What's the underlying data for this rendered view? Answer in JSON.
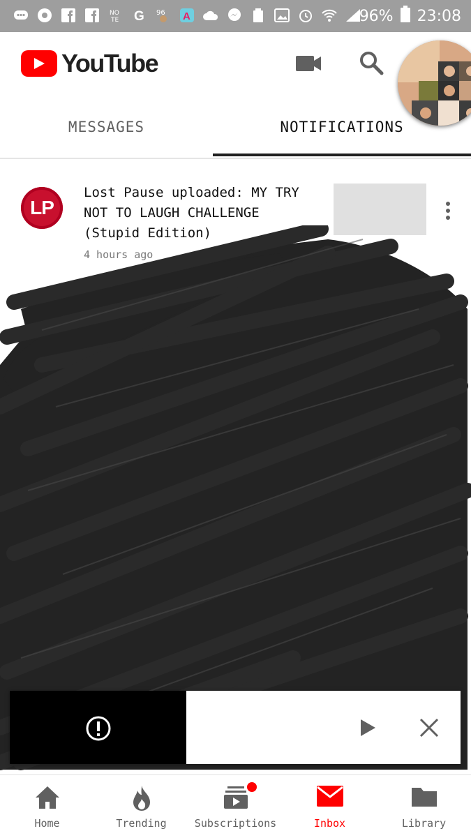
{
  "status_bar": {
    "battery": "96%",
    "time": "23:08",
    "icons": [
      "chat-icon",
      "chrome-icon",
      "facebook-icon",
      "facebook-icon",
      "note-icon",
      "google-icon",
      "notification-icon",
      "app-icon",
      "cloud-icon",
      "messenger-icon",
      "recycle-icon",
      "image-icon",
      "alarm-icon",
      "wifi-icon",
      "signal-icon",
      "battery-icon"
    ]
  },
  "header": {
    "brand": "YouTube",
    "brand_color": "#ff0000",
    "camera_icon": "video-camera-icon",
    "search_icon": "search-icon"
  },
  "tabs": [
    {
      "label": "MESSAGES",
      "active": false
    },
    {
      "label": "NOTIFICATIONS",
      "active": true
    }
  ],
  "notifications": [
    {
      "avatar_text": "LP",
      "text": "Lost Pause uploaded: MY TRY NOT TO LAUGH CHALLENGE (Stupid Edition)",
      "time": "4 hours ago"
    }
  ],
  "snackbar": {
    "icons": [
      "error-icon",
      "play-icon",
      "close-icon"
    ]
  },
  "bottom_nav": [
    {
      "label": "Home",
      "icon": "home-icon",
      "active": false
    },
    {
      "label": "Trending",
      "icon": "flame-icon",
      "active": false
    },
    {
      "label": "Subscriptions",
      "icon": "subscriptions-icon",
      "active": false,
      "badge": true
    },
    {
      "label": "Inbox",
      "icon": "inbox-icon",
      "active": true
    },
    {
      "label": "Library",
      "icon": "folder-icon",
      "active": false
    }
  ],
  "colors": {
    "status_bar": "#9e9e9e",
    "accent": "#ff0000",
    "scribble": "#232323"
  }
}
